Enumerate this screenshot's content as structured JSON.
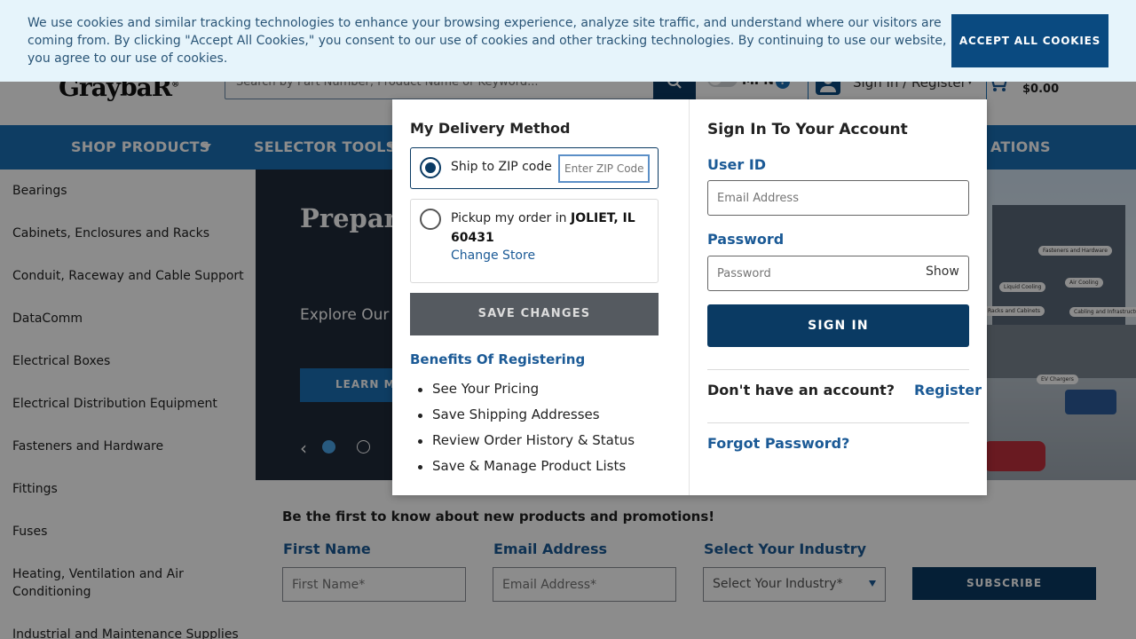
{
  "cookie_banner": {
    "text": "We use cookies and similar tracking technologies to enhance your browsing experience, analyze site traffic, and understand where our visitors are coming from. By clicking \"Accept All Cookies,\" you consent to our use of cookies and other tracking technologies. By continuing to use our website, you agree to our use of cookies.",
    "accept_label": "ACCEPT ALL COOKIES"
  },
  "header": {
    "logo_text": "GraybaR",
    "search_placeholder": "Search by Part Number, Product Name or Keyword...",
    "mpn_label": "MPN",
    "mpn_info": "?",
    "signin_label": "Sign In / Register",
    "cart_total": "$0.00"
  },
  "nav": {
    "shop_products": "SHOP PRODUCTS",
    "selector_tools": "SELECTOR TOOLS",
    "right_partial": "ATIONS"
  },
  "sidebar": {
    "categories": [
      "Bearings",
      "Cabinets, Enclosures and Racks",
      "Conduit, Raceway and Cable Support",
      "DataComm",
      "Electrical Boxes",
      "Electrical Distribution Equipment",
      "Fasteners and Hardware",
      "Fittings",
      "Fuses",
      "Heating, Ventilation and Air Conditioning",
      "Industrial and Maintenance Supplies"
    ]
  },
  "hero": {
    "title": "Prepare For Wh",
    "subtitle": "Explore Our",
    "button_label": "LEARN MO",
    "prev_arrow": "‹",
    "callouts": [
      "Fasteners and Hardware",
      "Liquid Cooling",
      "Air Cooling",
      "Racks and Cabinets",
      "Cabling and Infrastructure",
      "EV Chargers"
    ]
  },
  "newsletter": {
    "heading": "Be the first to know about new products and promotions!",
    "first_name_label": "First Name",
    "first_name_placeholder": "First Name*",
    "email_label": "Email Address",
    "email_placeholder": "Email Address*",
    "industry_label": "Select Your Industry",
    "industry_placeholder": "Select Your Industry*",
    "subscribe_label": "SUBSCRIBE"
  },
  "delivery": {
    "title": "My Delivery Method",
    "ship_label": "Ship to ZIP code",
    "zip_placeholder": "Enter ZIP Code",
    "pickup_text": "Pickup my order in",
    "pickup_store": "JOLIET, IL 60431",
    "change_store": "Change Store",
    "save_label": "SAVE CHANGES",
    "benefits_title": "Benefits Of Registering",
    "benefits": [
      "See Your Pricing",
      "Save Shipping Addresses",
      "Review Order History & Status",
      "Save & Manage Product Lists"
    ]
  },
  "signin": {
    "title": "Sign In To Your Account",
    "user_id_label": "User ID",
    "email_placeholder": "Email Address",
    "password_label": "Password",
    "password_placeholder": "Password",
    "show_label": "Show",
    "signin_button": "SIGN IN",
    "no_account": "Don't have an account?",
    "register": "Register",
    "forgot": "Forgot Password?"
  }
}
